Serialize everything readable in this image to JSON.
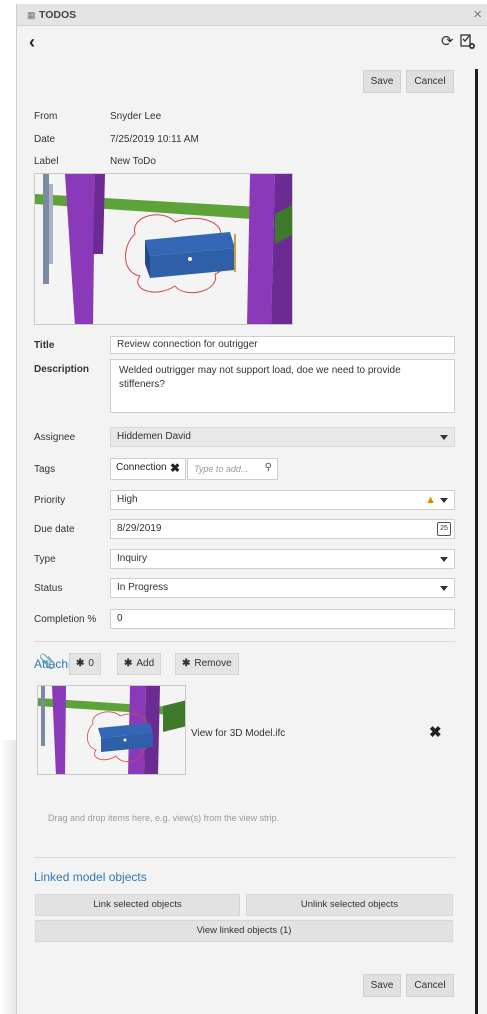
{
  "window": {
    "title": "TODOS"
  },
  "actions": {
    "save": "Save",
    "cancel": "Cancel"
  },
  "meta": [
    {
      "label": "From",
      "value": "Snyder Lee"
    },
    {
      "label": "Date",
      "value": "7/25/2019 10:11 AM"
    },
    {
      "label": "Label",
      "value": "New ToDo"
    }
  ],
  "form": {
    "title": {
      "label": "Title",
      "value": "Review connection for outrigger"
    },
    "description": {
      "label": "Description",
      "value": "Welded outrigger may not support load, doe we need to provide stiffeners?"
    },
    "assignee": {
      "label": "Assignee",
      "value": "Hiddemen David"
    },
    "tags": {
      "label": "Tags",
      "items": [
        "Connection"
      ],
      "placeholder": "Type to add..."
    },
    "priority": {
      "label": "Priority",
      "value": "High"
    },
    "due_date": {
      "label": "Due date",
      "value": "8/29/2019",
      "calendar_day": "25"
    },
    "type": {
      "label": "Type",
      "value": "Inquiry"
    },
    "status": {
      "label": "Status",
      "value": "In Progress"
    },
    "completion": {
      "label": "Completion %",
      "value": "0"
    }
  },
  "attachments": {
    "heading": "Attachments",
    "count": "0",
    "add_label": "Add",
    "remove_label": "Remove",
    "items": [
      {
        "name": "View for 3D Model.ifc"
      }
    ],
    "drop_hint": "Drag and drop items here, e.g. view(s) from the view strip."
  },
  "linked": {
    "heading": "Linked model objects",
    "link_label": "Link selected objects",
    "unlink_label": "Unlink selected objects",
    "view_label": "View linked objects (1)"
  },
  "icons": {
    "app": "todos-app-icon",
    "back": "back-chevron-icon",
    "refresh": "refresh-icon",
    "todo": "todo-settings-icon",
    "warning": "warning-icon",
    "calendar": "calendar-icon",
    "paperclip": "paperclip-icon",
    "gear": "gear-icon"
  },
  "colors": {
    "accent": "#2e79b6",
    "warning": "#e08a00",
    "beam_purple": "#8a3ab8",
    "beam_green": "#5da33a",
    "beam_blue": "#2f5fa8"
  }
}
